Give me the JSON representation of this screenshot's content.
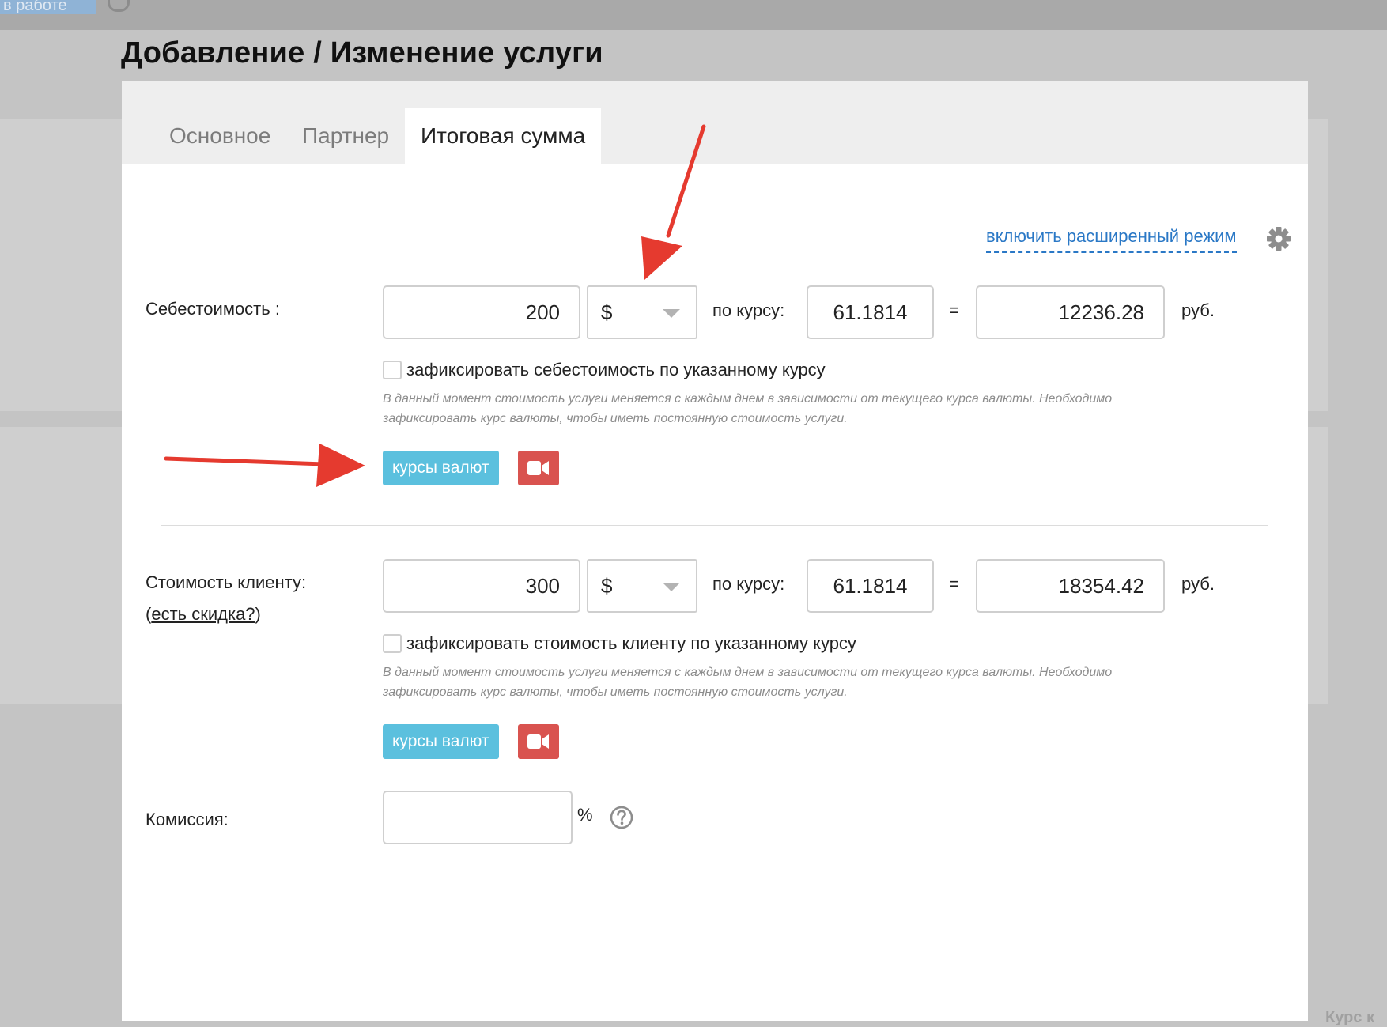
{
  "background": {
    "topbar_button_text": "в работе",
    "bottom_right_text": "Курс к"
  },
  "page_title": "Добавление / Изменение услуги",
  "tabs": [
    {
      "label": "Основное"
    },
    {
      "label": "Партнер"
    },
    {
      "label": "Итоговая сумма",
      "active": true
    }
  ],
  "advanced_mode_link": "включить расширенный режим",
  "cost": {
    "label": "Себестоимость :",
    "amount": "200",
    "currency": "$",
    "rate_label": "по курсу:",
    "rate": "61.1814",
    "equals": "=",
    "total": "12236.28",
    "total_unit": "руб.",
    "fix_checkbox_label": "зафиксировать себестоимость по указанному курсу",
    "fix_checked": false,
    "hint": "В данный момент стоимость услуги меняется с каждым днем в зависимости от текущего курса валюты. Необходимо зафиксировать курс валюты, чтобы иметь постоянную стоимость услуги.",
    "rates_button": "курсы валют"
  },
  "client_price": {
    "label": "Стоимость клиенту:",
    "discount_link": "есть скидка?",
    "discount_link_open": "(",
    "discount_link_close": ")",
    "amount": "300",
    "currency": "$",
    "rate_label": "по курсу:",
    "rate": "61.1814",
    "equals": "=",
    "total": "18354.42",
    "total_unit": "руб.",
    "fix_checkbox_label": "зафиксировать стоимость клиенту по указанному курсу",
    "fix_checked": false,
    "hint": "В данный момент стоимость услуги меняется с каждым днем в зависимости от текущего курса валюты. Необходимо зафиксировать курс валюты, чтобы иметь постоянную стоимость услуги.",
    "rates_button": "курсы валют"
  },
  "commission": {
    "label": "Комиссия:",
    "value": "",
    "unit": "%"
  },
  "colors": {
    "accent_blue": "#5bc0de",
    "video_red": "#d9534f",
    "link_blue": "#2a78c6",
    "annotation_red": "#e53a2f"
  },
  "icons": [
    "gear-icon",
    "video-camera-icon",
    "question-circle-icon",
    "chevron-down-icon",
    "annotation-arrow"
  ]
}
